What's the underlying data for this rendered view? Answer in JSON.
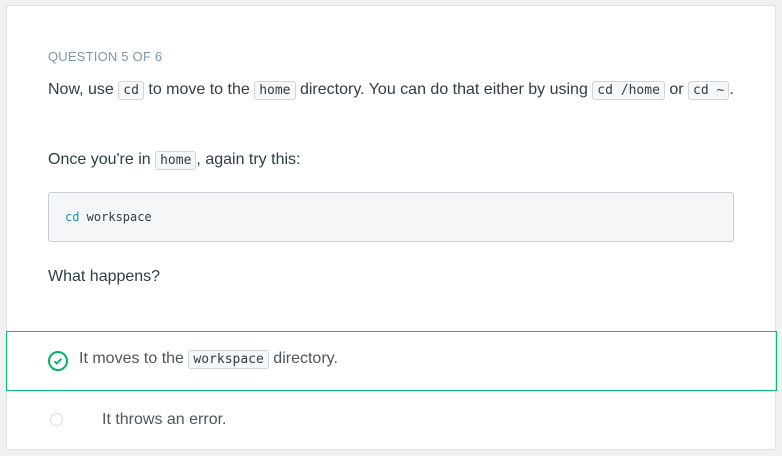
{
  "question": {
    "counter": "QUESTION 5 OF 6",
    "p1": [
      "Now, use ",
      "cd",
      " to move to the ",
      "home",
      " directory. You can do that either by using ",
      "cd /home",
      " or ",
      "cd ~",
      "."
    ],
    "p2": [
      "Once you're in ",
      "home",
      ", again try this:"
    ],
    "code": {
      "cmd": "cd",
      "arg": " workspace"
    },
    "prompt": "What happens?"
  },
  "options": [
    {
      "parts": [
        "It moves to the ",
        "workspace",
        " directory."
      ],
      "selected": true
    },
    {
      "label": "It throws an error.",
      "selected": false
    }
  ],
  "colors": {
    "accent": "#02b363"
  }
}
